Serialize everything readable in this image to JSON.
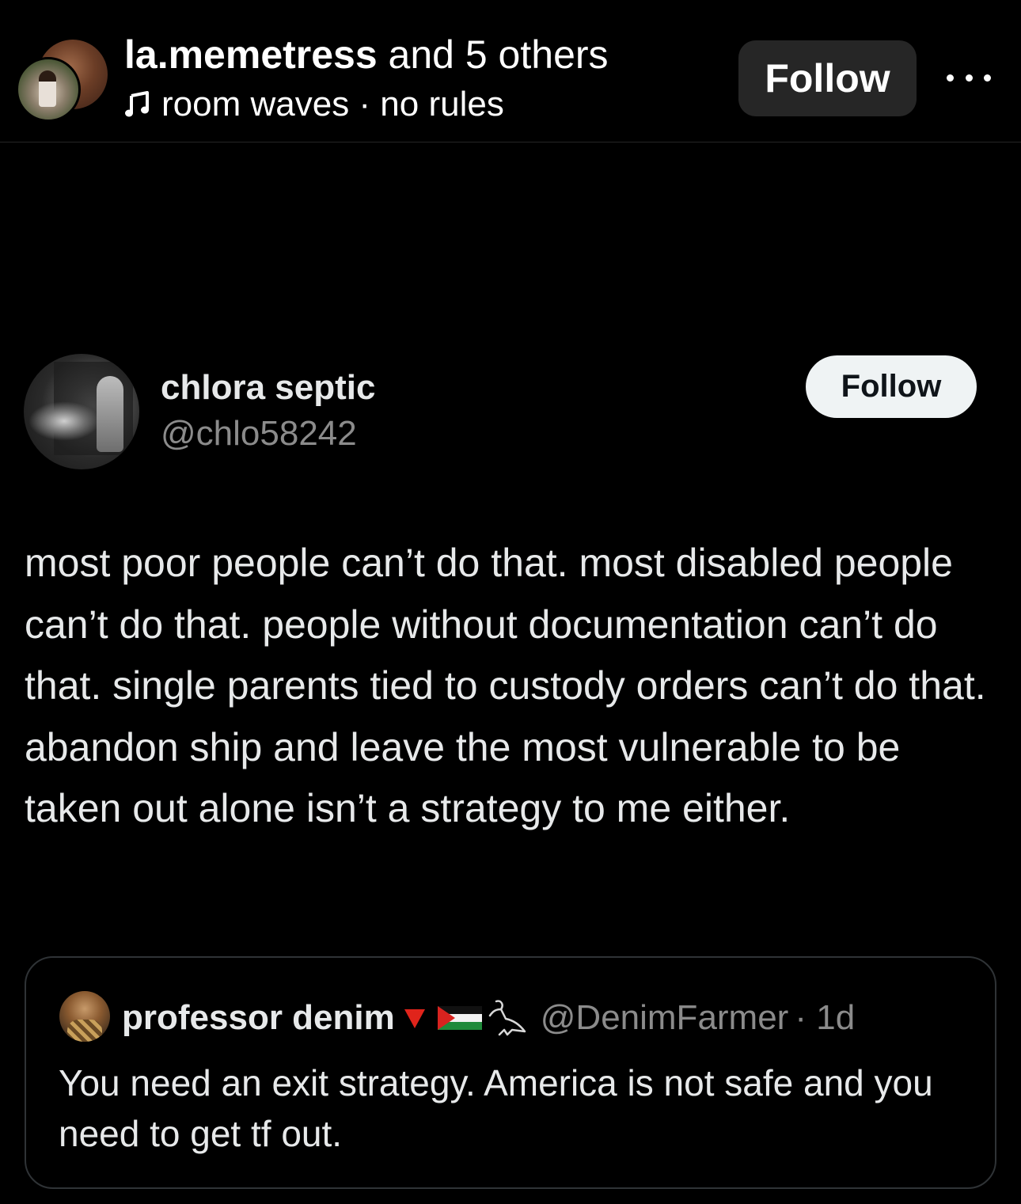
{
  "header": {
    "username": "la.memetress",
    "others_text": " and 5 others",
    "music_text": "room waves · no rules",
    "follow_label": "Follow",
    "more_icon": "ellipsis-icon",
    "music_icon": "music-note-icon"
  },
  "tweet": {
    "display_name": "chlora septic",
    "handle": "@chlo58242",
    "follow_label": "Follow",
    "text": "most poor people can’t do that. most disabled people can’t do that. people without documentation can’t do that. single parents tied to custody orders can’t do that. abandon ship and leave the most vulnerable to be taken out alone isn’t a strategy to me either."
  },
  "quoted_tweet": {
    "display_name": "professor denim",
    "handle": "@DenimFarmer",
    "time": "· 1d",
    "text": "You need an exit strategy. America is not safe and you need to get tf out.",
    "icons": [
      "red-triangle-icon",
      "palestine-flag-icon",
      "ibis-bird-icon"
    ]
  },
  "colors": {
    "background": "#000000",
    "primary_text": "#e7e9ea",
    "secondary_text": "#8b8b8b",
    "header_button": "#262626",
    "tweet_button": "#eff3f4",
    "quote_border": "#2f3336",
    "triangle": "#e0241b"
  }
}
